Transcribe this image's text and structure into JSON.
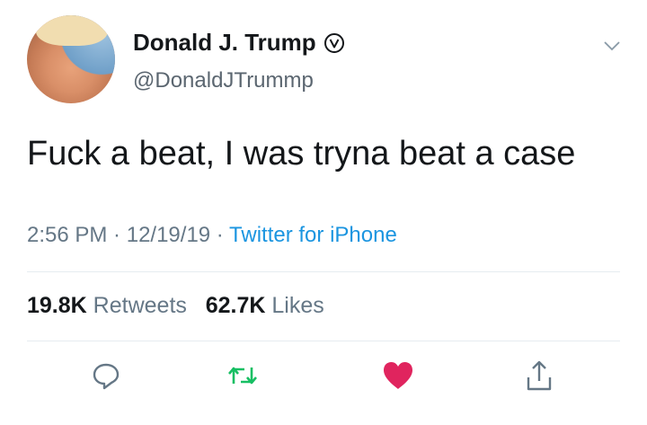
{
  "author": {
    "name": "Donald J. Trump",
    "handle": "@DonaldJTrummp",
    "verified_icon": "verified-badge-icon"
  },
  "tweet": {
    "text": "Fuck a beat, I was tryna beat a case",
    "time": "2:56 PM",
    "date": "12/19/19",
    "source": "Twitter for iPhone",
    "separator": " · "
  },
  "stats": {
    "retweets_count": "19.8K",
    "retweets_label": "Retweets",
    "likes_count": "62.7K",
    "likes_label": "Likes"
  },
  "actions": {
    "reply_icon": "reply-icon",
    "retweet_icon": "retweet-icon",
    "like_icon": "heart-icon",
    "share_icon": "share-icon"
  },
  "colors": {
    "retweet_green": "#17bf63",
    "like_red": "#e0245e",
    "link_blue": "#1b95e0",
    "muted_gray": "#657786"
  }
}
